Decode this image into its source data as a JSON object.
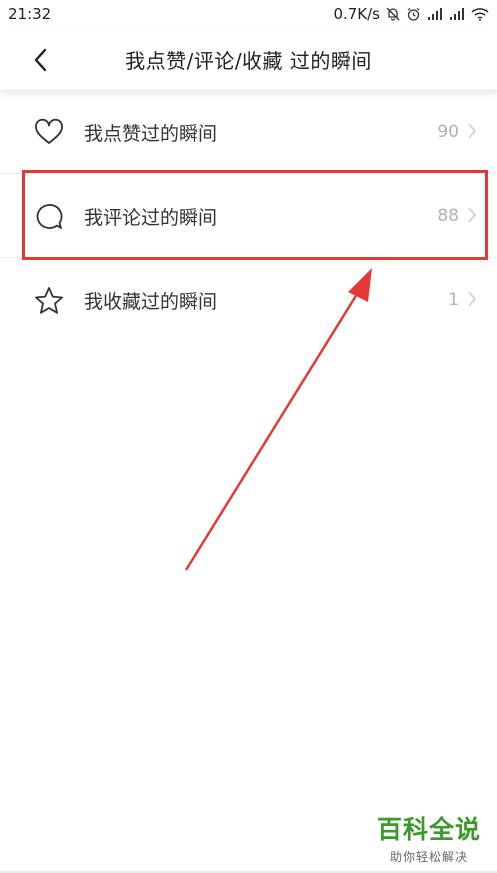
{
  "status_bar": {
    "time": "21:32",
    "network_speed": "0.7K/s",
    "icons": [
      "mute-bell-icon",
      "alarm-icon",
      "signal-icon",
      "signal-icon",
      "wifi-icon"
    ]
  },
  "header": {
    "title": "我点赞/评论/收藏 过的瞬间",
    "back_icon": "chevron-left-icon"
  },
  "list": {
    "items": [
      {
        "label": "我点赞过的瞬间",
        "count": "90",
        "icon": "heart-icon"
      },
      {
        "label": "我评论过的瞬间",
        "count": "88",
        "icon": "comment-bubble-icon"
      },
      {
        "label": "我收藏过的瞬间",
        "count": "1",
        "icon": "star-icon"
      }
    ]
  },
  "annotation": {
    "highlight_color": "#e53935",
    "highlighted_item": "我评论过的瞬间"
  },
  "watermark": {
    "main": "百科全说",
    "sub": "助你轻松解决",
    "color": "#3c9a2b"
  }
}
